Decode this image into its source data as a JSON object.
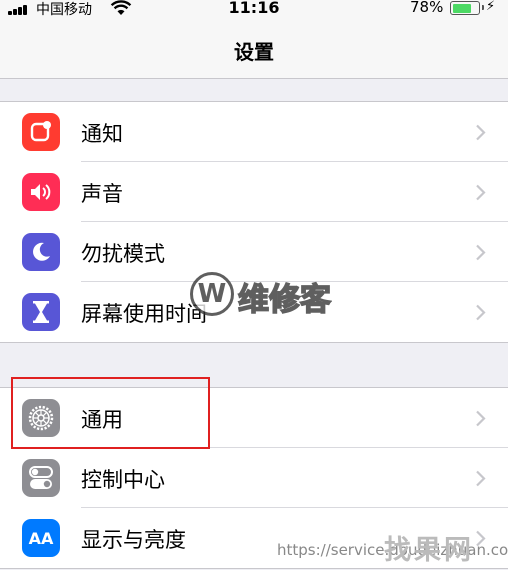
{
  "status_bar": {
    "carrier": "中国移动",
    "time": "11:16",
    "battery_percent": "78%",
    "battery_level": 0.78
  },
  "nav": {
    "title": "设置"
  },
  "groups": [
    {
      "items": [
        {
          "label": "通知",
          "icon": "notifications-icon",
          "color": "#ff3b30"
        },
        {
          "label": "声音",
          "icon": "sounds-icon",
          "color": "#ff2d55"
        },
        {
          "label": "勿扰模式",
          "icon": "moon-icon",
          "color": "#5856d6"
        },
        {
          "label": "屏幕使用时间",
          "icon": "hourglass-icon",
          "color": "#5856d6"
        }
      ]
    },
    {
      "items": [
        {
          "label": "通用",
          "icon": "gear-icon",
          "color": "#8e8e93"
        },
        {
          "label": "控制中心",
          "icon": "toggles-icon",
          "color": "#8e8e93"
        },
        {
          "label": "显示与亮度",
          "icon": "aa-icon",
          "color": "#007aff",
          "glyph": "AA"
        }
      ]
    }
  ],
  "watermarks": {
    "logo_letter": "W",
    "brand": "维修客",
    "url": "https://service.doudeizhuan.com",
    "corner": "找果网"
  },
  "highlight": {
    "color": "#e02020"
  }
}
